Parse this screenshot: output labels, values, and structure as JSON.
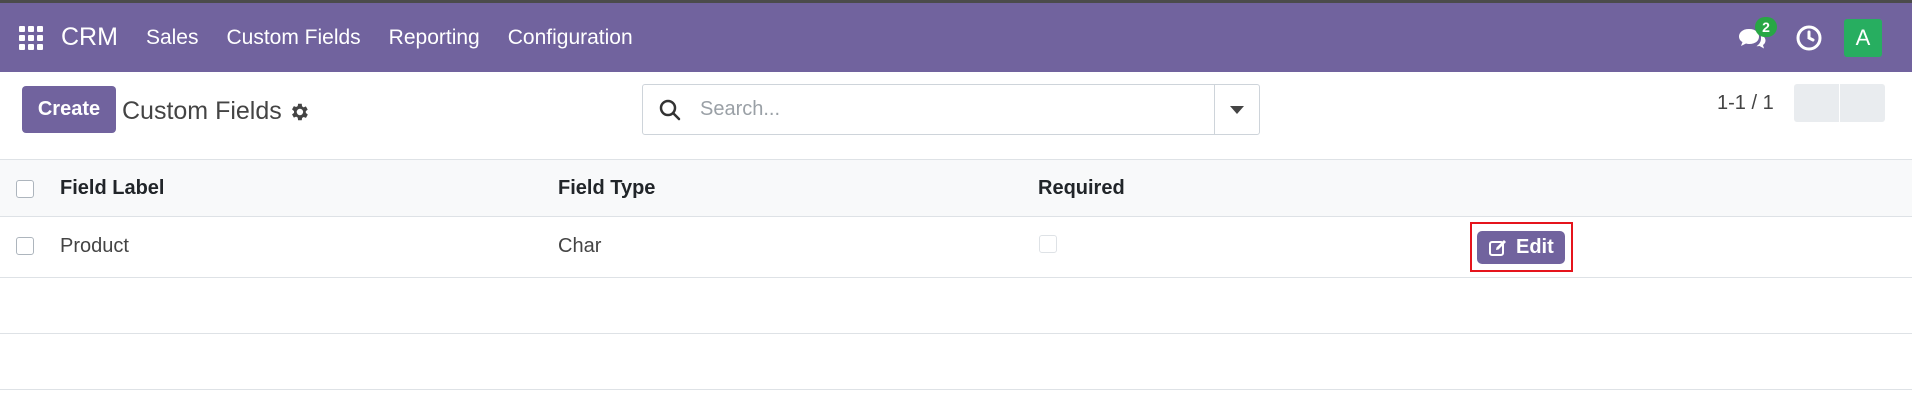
{
  "topbar": {
    "brand": "CRM",
    "menu": [
      {
        "label": "Sales"
      },
      {
        "label": "Custom Fields"
      },
      {
        "label": "Reporting"
      },
      {
        "label": "Configuration"
      }
    ],
    "messages_count": "2",
    "avatar_letter": "A"
  },
  "control_panel": {
    "create_label": "Create",
    "title": "Custom Fields",
    "search_placeholder": "Search...",
    "pager": "1-1 / 1"
  },
  "list": {
    "columns": [
      "Field Label",
      "Field Type",
      "Required"
    ],
    "rows": [
      {
        "field_label": "Product",
        "field_type": "Char",
        "required": false,
        "action_label": "Edit"
      }
    ]
  },
  "colors": {
    "brand": "#71639e",
    "badge": "#28a745",
    "avatar": "#27ae60",
    "highlight": "#e5141c"
  },
  "icons": [
    "apps-grid-icon",
    "chat-icon",
    "clock-icon",
    "gear-icon",
    "search-icon",
    "caret-down-icon",
    "edit-icon"
  ]
}
